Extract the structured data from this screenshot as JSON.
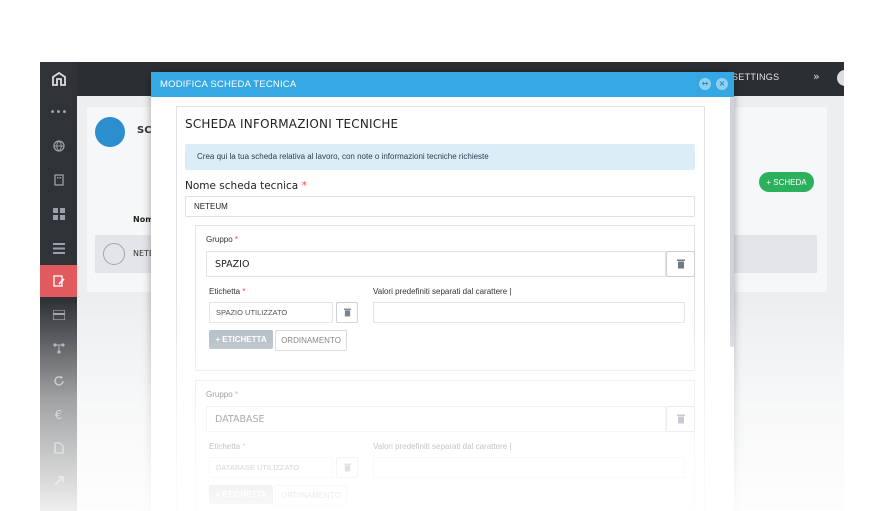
{
  "topbar": {
    "settings_label": "SETTINGS",
    "chevron": "»",
    "caret": "⌄"
  },
  "background": {
    "card_title": "SCI",
    "add_button": "+ SCHEDA",
    "column_header": "Nom",
    "row_text": "NETE"
  },
  "modal": {
    "title": "MODIFICA SCHEDA TECNICA",
    "panel_title": "SCHEDA INFORMAZIONI TECNICHE",
    "info_text": "Crea qui la tua scheda relativa al lavoro, con note o informazioni tecniche richieste",
    "name_label": "Nome scheda tecnica",
    "required_mark": "*",
    "name_value": "NETEUM",
    "groups": [
      {
        "label": "Gruppo",
        "value": "SPAZIO",
        "etichetta_label": "Etichetta",
        "valori_label": "Valori predefiniti separati dal carattere |",
        "etichetta_value": "SPAZIO UTILIZZATO",
        "add_button": "+ ETICHETTA",
        "order_button": "ORDINAMENTO"
      },
      {
        "label": "Gruppo",
        "value": "DATABASE",
        "etichetta_label": "Etichetta",
        "valori_label": "Valori predefiniti separati dal carattere |",
        "etichetta_value": "DATABASE UTILIZZATO",
        "add_button": "+ ETICHETTA",
        "order_button": "ORDINAMENTO"
      }
    ]
  },
  "colors": {
    "header_blue": "#35a7e3",
    "sidebar": "#2f3236",
    "active_item": "#e15b5e",
    "success": "#2bb15c"
  },
  "icons": {
    "sidebar": [
      "logo-icon",
      "dots-icon",
      "globe-icon",
      "building-icon",
      "grid-icon",
      "list-icon",
      "edit-icon",
      "card-icon",
      "hierarchy-icon",
      "sync-icon",
      "euro-icon",
      "document-icon",
      "share-icon"
    ],
    "modal": [
      "expand-icon",
      "close-icon",
      "trash-icon"
    ]
  }
}
